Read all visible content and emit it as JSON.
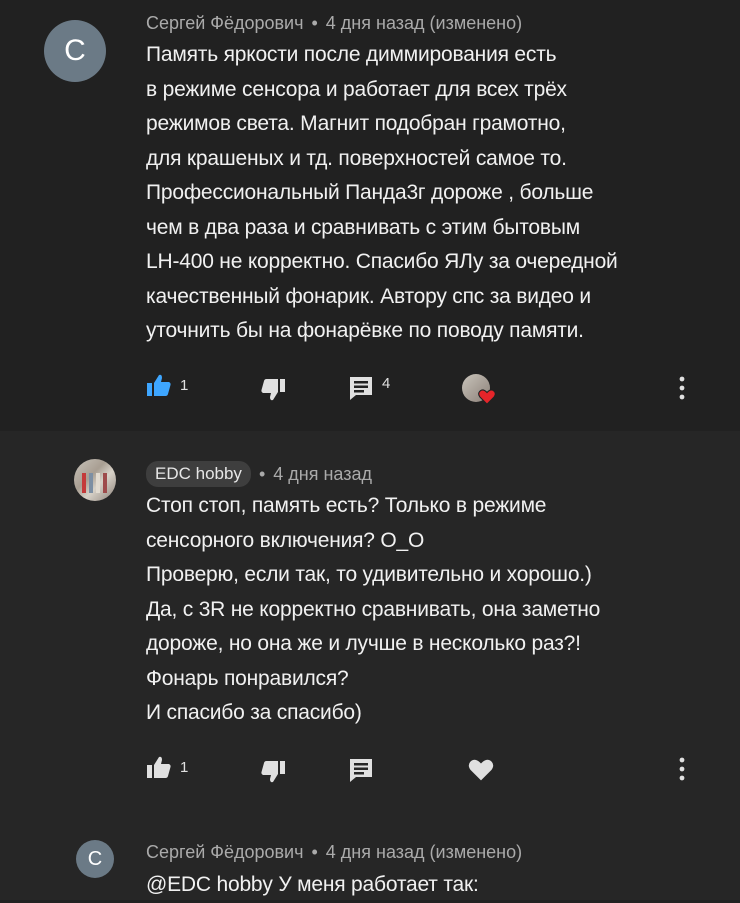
{
  "comments": [
    {
      "avatar_letter": "С",
      "author": "Сергей Фёдорович",
      "time": "4 дня назад (изменено)",
      "text": "Память яркости после диммирования есть\nв режиме сенсора и работает для всех трёх\nрежимов света. Магнит подобран грамотно,\nдля крашеных и тд. поверхностей самое то.\nПрофессиональный Панда3г дороже , больше\nчем в два раза и сравнивать с этим бытовым\nLH-400 не корректно. Спасибо ЯЛу за очередной\nкачественный фонарик. Автору спс за видео и\nуточнить бы на фонарёвке по поводу памяти.",
      "likes": "1",
      "replies": "4",
      "liked": true,
      "creator_heart": true
    },
    {
      "author": "EDC hobby",
      "time": "4 дня назад",
      "text": "Стоп стоп, память есть? Только в режиме\nсенсорного включения? О_О\nПроверю, если так, то удивительно и хорошо.)\nДа, с 3R не корректно сравнивать, она заметно\nдороже, но она же и лучше в несколько раз?!\nФонарь понравился?\nИ спасибо за спасибо)",
      "likes": "1"
    },
    {
      "avatar_letter": "С",
      "author": "Сергей Фёдорович",
      "time": "4 дня назад (изменено)",
      "text": "@EDC hobby У меня работает так:"
    }
  ],
  "separator": "•",
  "colors": {
    "like_active": "#3ea6ff",
    "heart": "#e5252a",
    "icon": "#e0e0e0"
  }
}
